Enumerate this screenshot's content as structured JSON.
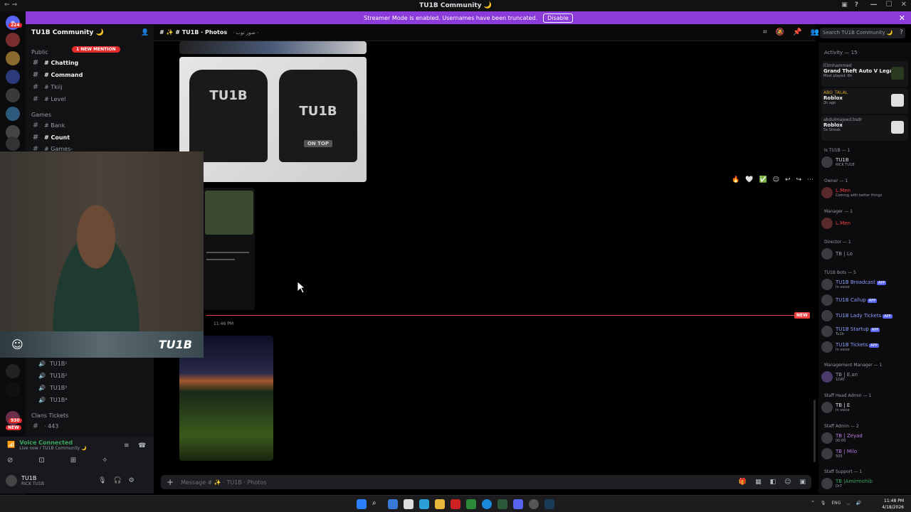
{
  "window": {
    "title": "TU1B Community 🌙"
  },
  "banner": {
    "text": "Streamer Mode is enabled. Usernames have been truncated.",
    "button": "Disable"
  },
  "servers": {
    "badge_top": "224",
    "badge_new": "NEW",
    "badge_930": "930"
  },
  "guild": {
    "name": "TU1B Community 🌙",
    "mention_badge": "1 NEW MENTION"
  },
  "channels": {
    "public_header": "Public",
    "games_header": "Games",
    "clans_header": "Clans Tickets",
    "items": [
      {
        "label": "# Chatting"
      },
      {
        "label": "# Command"
      },
      {
        "label": "# Tkiij"
      },
      {
        "label": "# Level"
      },
      {
        "label": "# Bank"
      },
      {
        "label": "# Count"
      },
      {
        "label": "# Games-"
      }
    ],
    "voice": [
      "TU1B¹",
      "TU1B²",
      "TU1B³",
      "TU1B⁴"
    ],
    "ticket": "· 443"
  },
  "webcam": {
    "brand": "TU1B"
  },
  "chat": {
    "channel": "# ✨ # TU1B · Photos",
    "topic": "· صور توب ·",
    "search_placeholder": "Search TU1B Community 🌙",
    "shirt_left": "TU1B",
    "shirt_right": "TU1B",
    "shirt_right_sub": "ON TOP",
    "timestamp": "11:46 PM",
    "new_tag": "NEW",
    "message_placeholder": "Message # ✨ · TU1B · Photos"
  },
  "user": {
    "voice_status": "Voice Connected",
    "voice_sub": "Live now / TU1B Community 🌙",
    "name": "TU1B",
    "sub": "RICK TU1B"
  },
  "members": {
    "activity_header": "Activity — 15",
    "activities": [
      {
        "user": "ll3mhammed",
        "title": "Grand Theft Auto V Legacy",
        "sub": "Most played: 6h"
      },
      {
        "user": "ABO_TALAL",
        "title": "Roblox",
        "sub": "2h ago"
      },
      {
        "user": "abdulmajeed.bsdr",
        "title": "Roblox",
        "sub": "5x Streak"
      }
    ],
    "roles": [
      {
        "header": "Is TU1B — 1",
        "members": [
          {
            "name": "TU1B",
            "sub": "RICK TU1B"
          }
        ]
      },
      {
        "header": "Owner — 1",
        "members": [
          {
            "name": "L.Men",
            "sub": "Coming with better things"
          }
        ]
      },
      {
        "header": "Manager — 1",
        "members": [
          {
            "name": "L.Men",
            "sub": ""
          }
        ]
      },
      {
        "header": "Director — 1",
        "members": [
          {
            "name": "TB | Lo",
            "sub": ""
          }
        ]
      },
      {
        "header": "TU1B Bots — 5",
        "members": [
          {
            "name": "TU1B Broadcast",
            "sub": "In voice",
            "app": "APP"
          },
          {
            "name": "TU1B Callup",
            "sub": "",
            "app": "APP"
          },
          {
            "name": "TU1B Lady Tickets",
            "sub": "",
            "app": "APP"
          },
          {
            "name": "TU1B Startup",
            "sub": "Tu1b",
            "app": "APP"
          },
          {
            "name": "TU1B Tickets",
            "sub": "In voice",
            "app": "APP"
          }
        ]
      },
      {
        "header": "Management Manager — 1",
        "members": [
          {
            "name": "TB | E.xn",
            "sub": "1DAY"
          }
        ]
      },
      {
        "header": "Staff Head Admin — 1",
        "members": [
          {
            "name": "TB | E",
            "sub": "In voice"
          }
        ]
      },
      {
        "header": "Staff Admin — 2",
        "members": [
          {
            "name": "TB | Zeyad",
            "sub": "00:00"
          },
          {
            "name": "TB | Milo",
            "sub": "505"
          }
        ]
      },
      {
        "header": "Staff Support — 1",
        "members": [
          {
            "name": "TB |Amirmohib",
            "sub": "Dr7"
          }
        ]
      }
    ]
  },
  "taskbar": {
    "lang": "ENG",
    "time": "11:48 PM",
    "date": "4/18/2026"
  }
}
